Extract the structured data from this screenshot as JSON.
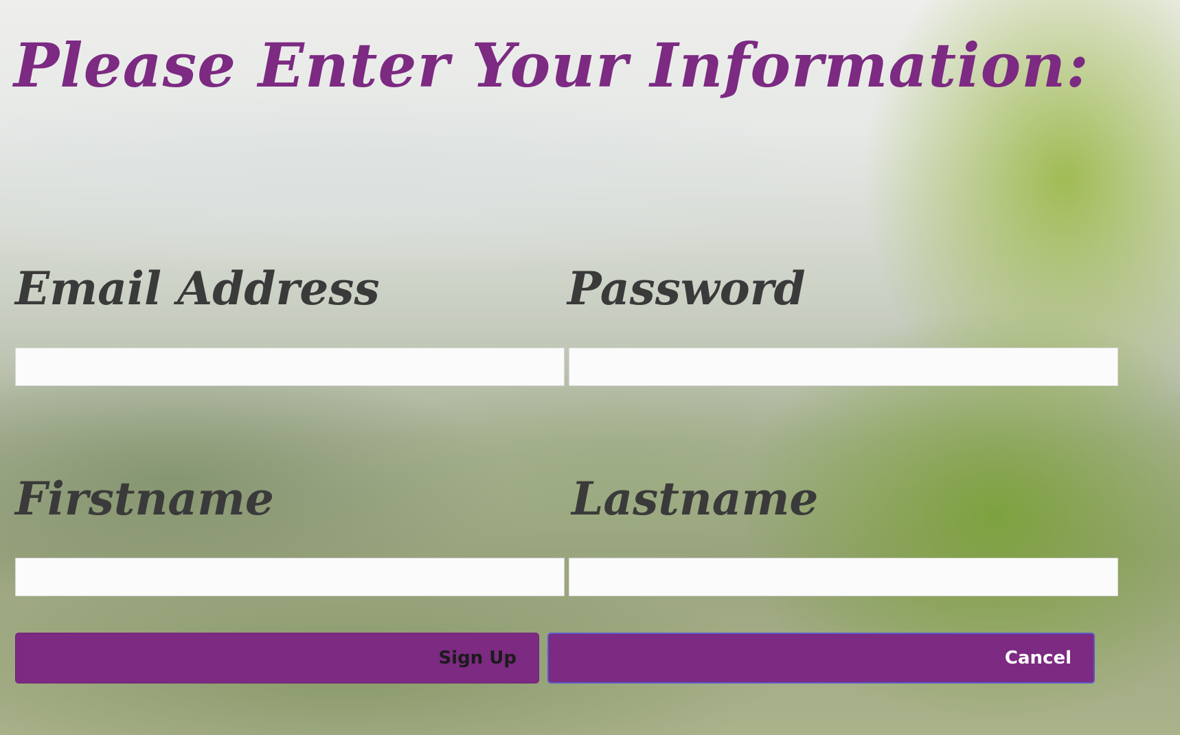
{
  "page": {
    "title": "Please Enter Your Information:"
  },
  "form": {
    "email": {
      "label": "Email Address",
      "value": "",
      "placeholder": ""
    },
    "password": {
      "label": "Password",
      "value": "",
      "placeholder": ""
    },
    "firstname": {
      "label": "Firstname",
      "value": "",
      "placeholder": ""
    },
    "lastname": {
      "label": "Lastname",
      "value": "",
      "placeholder": ""
    }
  },
  "buttons": {
    "signup_label": "Sign Up",
    "cancel_label": "Cancel"
  },
  "colors": {
    "accent": "#7c2a82",
    "label_text": "#3a3a3a",
    "field_background": "#fbfbfb"
  }
}
